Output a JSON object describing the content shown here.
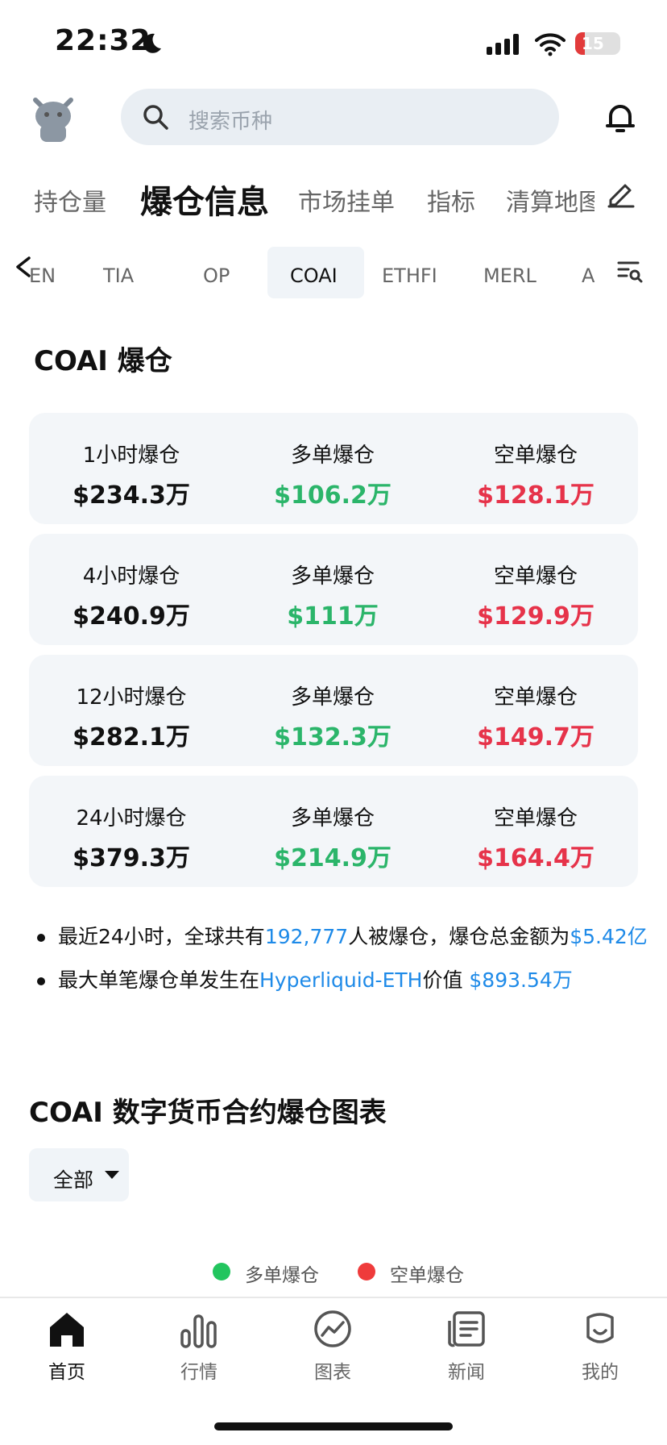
{
  "status": {
    "time": "22:32",
    "battery": "15"
  },
  "search": {
    "placeholder": "搜索币种"
  },
  "top_tabs": [
    {
      "label": "持仓量"
    },
    {
      "label": "爆仓信息",
      "active": true
    },
    {
      "label": "市场挂单"
    },
    {
      "label": "指标"
    },
    {
      "label": "清算地图"
    }
  ],
  "coin_tabs": [
    {
      "label": "EN"
    },
    {
      "label": "TIA"
    },
    {
      "label": "OP"
    },
    {
      "label": "COAI",
      "active": true
    },
    {
      "label": "ETHFI"
    },
    {
      "label": "MERL"
    },
    {
      "label": "A"
    }
  ],
  "section": {
    "title": "COAI 爆仓"
  },
  "cards": [
    {
      "period": "1小时爆仓",
      "total": "$234.3万",
      "long_label": "多单爆仓",
      "long": "$106.2万",
      "short_label": "空单爆仓",
      "short": "$128.1万"
    },
    {
      "period": "4小时爆仓",
      "total": "$240.9万",
      "long_label": "多单爆仓",
      "long": "$111万",
      "short_label": "空单爆仓",
      "short": "$129.9万"
    },
    {
      "period": "12小时爆仓",
      "total": "$282.1万",
      "long_label": "多单爆仓",
      "long": "$132.3万",
      "short_label": "空单爆仓",
      "short": "$149.7万"
    },
    {
      "period": "24小时爆仓",
      "total": "$379.3万",
      "long_label": "多单爆仓",
      "long": "$214.9万",
      "short_label": "空单爆仓",
      "short": "$164.4万"
    }
  ],
  "summary": {
    "line1_prefix": "最近24小时，全球共有",
    "line1_count": "192,777",
    "line1_mid": "人被爆仓，爆仓总金额为",
    "line1_amount": "$5.42亿",
    "line2_prefix": "最大单笔爆仓单发生在",
    "line2_exchange": "Hyperliquid-ETH",
    "line2_mid": "价值 ",
    "line2_amount": "$893.54万"
  },
  "chart_section": {
    "title": "COAI 数字货币合约爆仓图表",
    "filter": "全部",
    "legend": [
      {
        "label": "多单爆仓",
        "color": "#22c55e"
      },
      {
        "label": "空单爆仓",
        "color": "#ef3b3b"
      }
    ]
  },
  "nav": [
    {
      "label": "首页",
      "icon": "home-icon",
      "active": true
    },
    {
      "label": "行情",
      "icon": "market-icon"
    },
    {
      "label": "图表",
      "icon": "chart-icon"
    },
    {
      "label": "新闻",
      "icon": "news-icon"
    },
    {
      "label": "我的",
      "icon": "profile-icon"
    }
  ]
}
